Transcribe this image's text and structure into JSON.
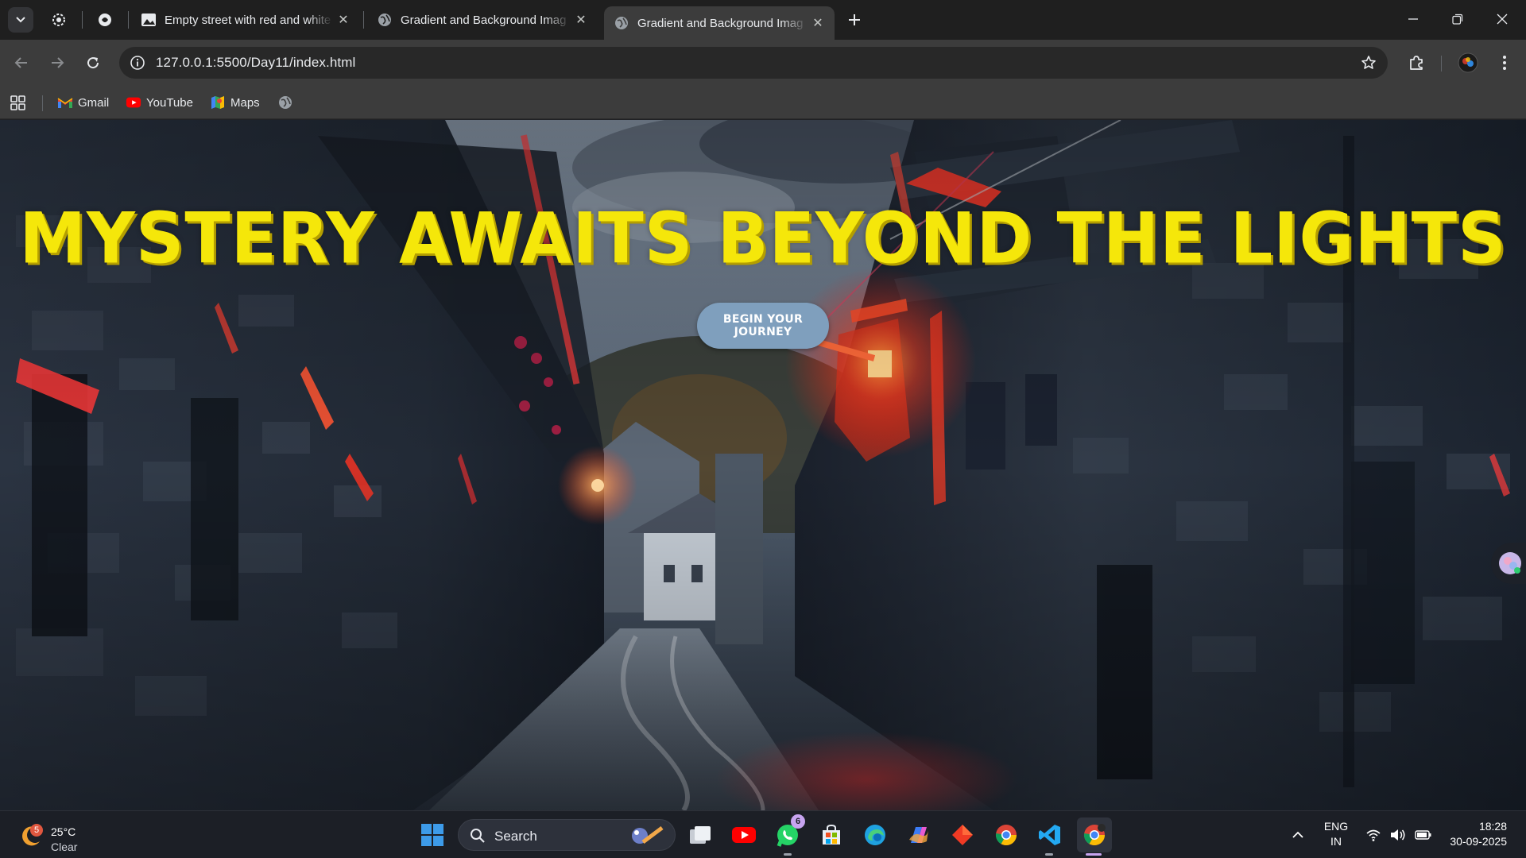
{
  "browser": {
    "tabs": [
      {
        "title": "Empty street with red and white",
        "active": false
      },
      {
        "title": "Gradient and Background Imag",
        "active": false
      },
      {
        "title": "Gradient and Background Imag",
        "active": true
      }
    ],
    "url": "127.0.0.1:5500/Day11/index.html",
    "bookmarks": [
      {
        "label": "Gmail",
        "icon": "gmail-icon"
      },
      {
        "label": "YouTube",
        "icon": "youtube-icon"
      },
      {
        "label": "Maps",
        "icon": "maps-icon"
      }
    ]
  },
  "page": {
    "headline": "MYSTERY AWAITS BEYOND THE LIGHTS",
    "cta_label": "BEGIN YOUR JOURNEY",
    "headline_color": "#f5e70a",
    "button_color": "#7f9fbd"
  },
  "taskbar": {
    "weather_temp": "25°C",
    "weather_condition": "Clear",
    "weather_badge": "5",
    "search_label": "Search",
    "whatsapp_badge": "6",
    "language_top": "ENG",
    "language_bottom": "IN",
    "time": "18:28",
    "date": "30-09-2025"
  }
}
